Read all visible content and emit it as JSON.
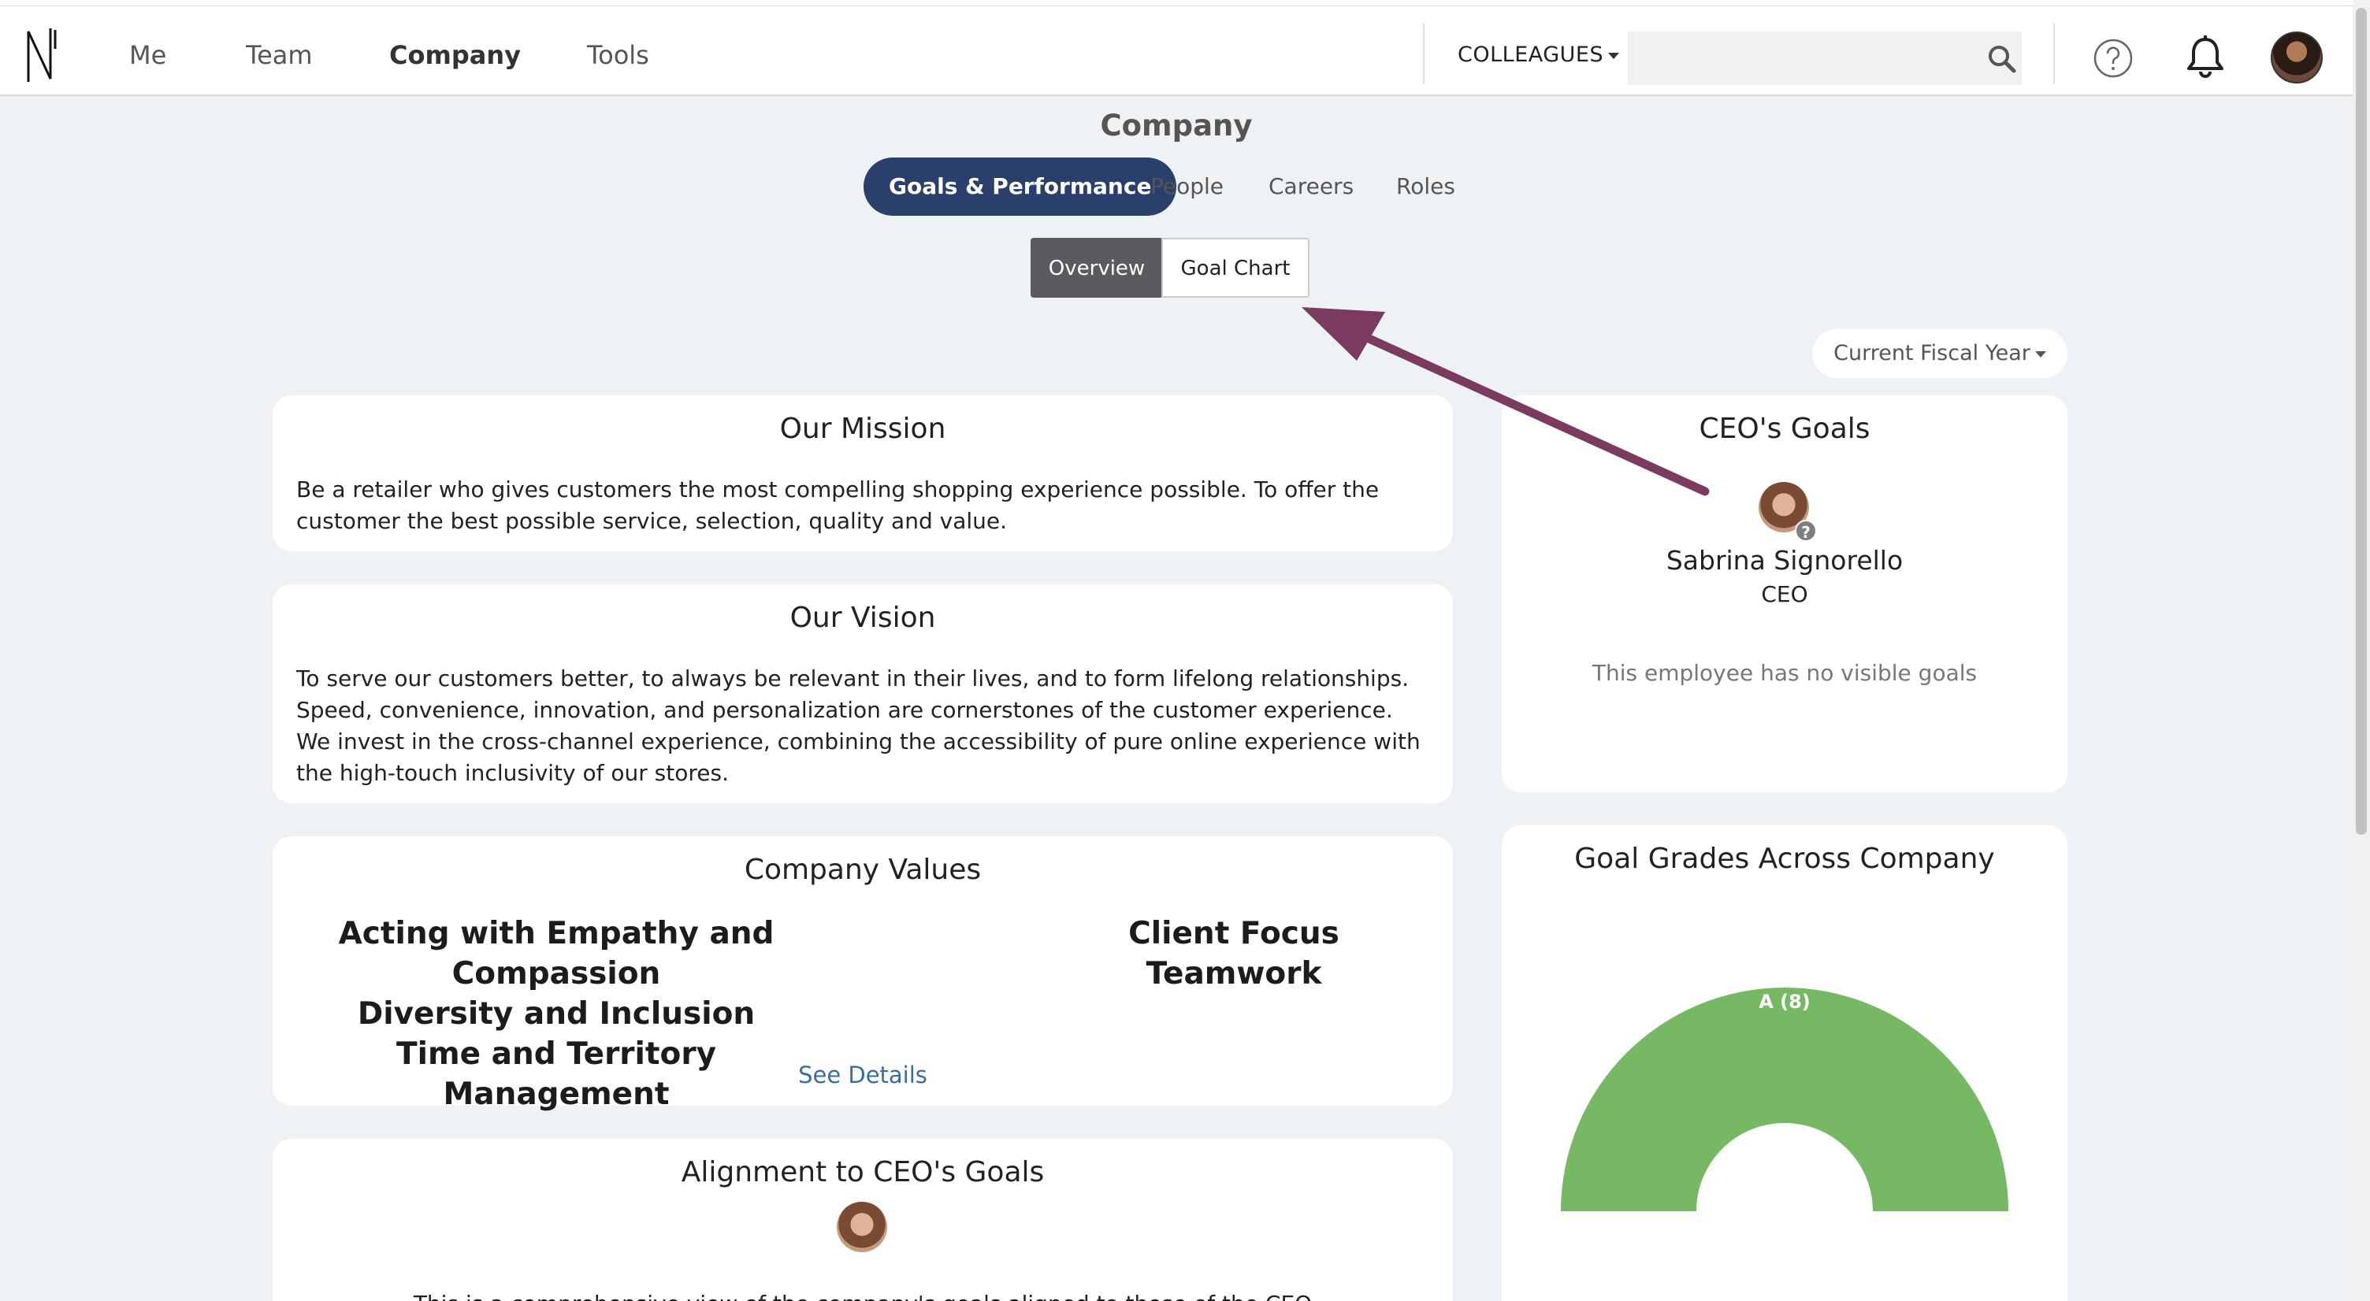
{
  "nav": {
    "items": [
      {
        "label": "Me",
        "active": false
      },
      {
        "label": "Team",
        "active": false
      },
      {
        "label": "Company",
        "active": true
      },
      {
        "label": "Tools",
        "active": false
      }
    ],
    "colleagues_label": "COLLEAGUES",
    "search_placeholder": "",
    "icons": [
      "logo-icon",
      "caret-down-icon",
      "search-icon",
      "help-icon",
      "bell-icon",
      "avatar"
    ]
  },
  "page": {
    "title": "Company",
    "tabs": [
      {
        "label": "Goals & Performance",
        "active": true
      },
      {
        "label": "People",
        "active": false
      },
      {
        "label": "Careers",
        "active": false
      },
      {
        "label": "Roles",
        "active": false
      }
    ],
    "subtabs": [
      {
        "label": "Overview",
        "active": true
      },
      {
        "label": "Goal Chart",
        "active": false
      }
    ],
    "period_label": "Current Fiscal Year"
  },
  "mission": {
    "title": "Our Mission",
    "text": "Be a retailer who gives customers the most compelling shopping experience possible. To offer the customer the best possible service, selection, quality and value."
  },
  "vision": {
    "title": "Our Vision",
    "text": "To serve our customers better, to always be relevant in their lives, and to form lifelong relationships. Speed, convenience, innovation, and personalization are cornerstones of the customer experience. We invest in the cross-channel experience, combining the accessibility of pure online experience with the high-touch inclusivity of our stores."
  },
  "values": {
    "title": "Company Values",
    "left": [
      "Acting with Empathy and Compassion",
      "Diversity and Inclusion",
      "Time and Territory Management"
    ],
    "right": [
      "Client Focus",
      "Teamwork"
    ],
    "link_label": "See Details"
  },
  "alignment": {
    "title": "Alignment to CEO's Goals",
    "text": "This is a comprehensive view of the company's goals aligned to those of the CEO"
  },
  "ceo": {
    "title": "CEO's Goals",
    "name": "Sabrina Signorello",
    "role": "CEO",
    "badge": "?",
    "empty_message": "This employee has no visible goals"
  },
  "grades": {
    "title": "Goal Grades Across Company"
  },
  "chart_data": {
    "type": "pie",
    "variant": "half-donut",
    "title": "Goal Grades Across Company",
    "slices": [
      {
        "label": "A (8)",
        "value": 8,
        "color": "#77b865"
      }
    ]
  },
  "colors": {
    "accent": "#2b3f6c",
    "annotation_arrow": "#7b3a60",
    "chart_green": "#77b865"
  }
}
